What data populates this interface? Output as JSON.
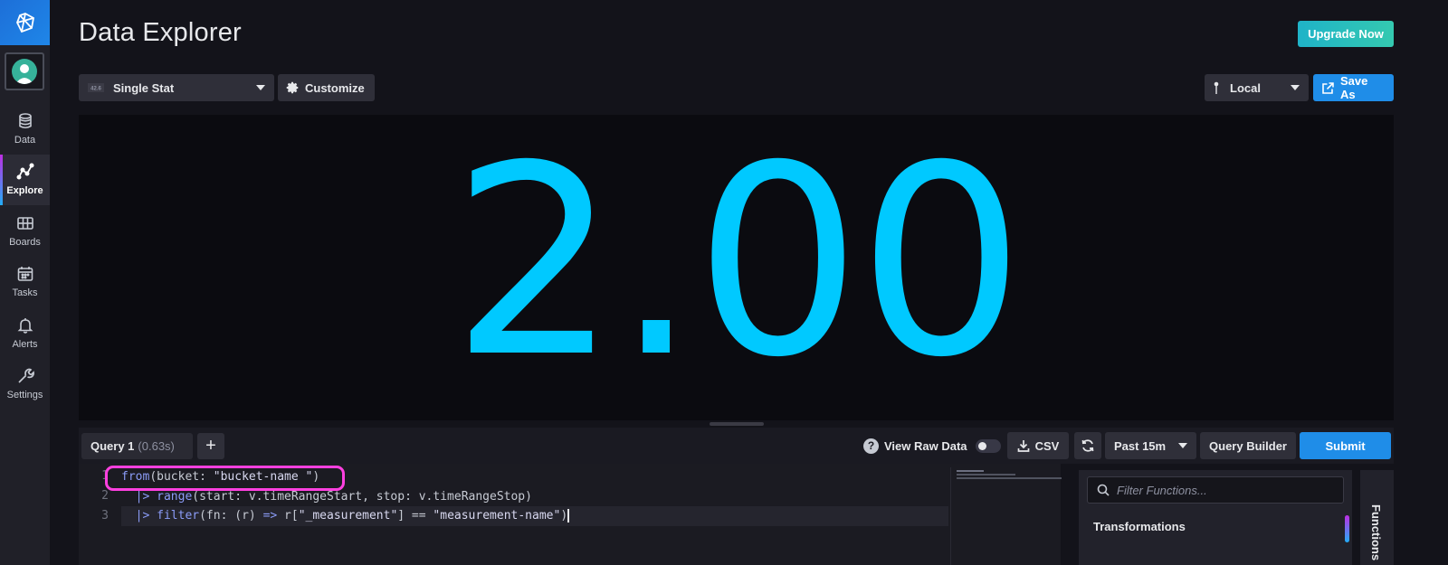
{
  "page": {
    "title": "Data Explorer"
  },
  "header": {
    "upgrade_label": "Upgrade Now"
  },
  "sidebar": {
    "items": [
      {
        "label": "Data",
        "icon": "database-icon"
      },
      {
        "label": "Explore",
        "icon": "graph-icon",
        "active": true
      },
      {
        "label": "Boards",
        "icon": "grid-icon"
      },
      {
        "label": "Tasks",
        "icon": "calendar-icon"
      },
      {
        "label": "Alerts",
        "icon": "bell-icon"
      },
      {
        "label": "Settings",
        "icon": "wrench-icon"
      }
    ]
  },
  "toolbar": {
    "visualization_type": "Single Stat",
    "customize_label": "Customize",
    "timezone": "Local",
    "save_as_label": "Save As"
  },
  "visualization": {
    "stat_value": "2.00",
    "color": "#00c9ff"
  },
  "query_bar": {
    "tab_label": "Query 1",
    "tab_time": "(0.63s)",
    "add_label": "+",
    "raw_data_label": "View Raw Data",
    "raw_data_enabled": false,
    "csv_label": "CSV",
    "time_range": "Past 15m",
    "query_builder_label": "Query Builder",
    "submit_label": "Submit"
  },
  "editor": {
    "lines": [
      {
        "num": "1",
        "pre": "",
        "fn": "from",
        "rest": "(bucket: ",
        "str": "\"bucket-name \"",
        "post": ")"
      },
      {
        "num": "2",
        "pre": "  ",
        "op": "|>",
        "fn": "range",
        "rest": "(start: v.timeRangeStart, stop: v.timeRangeStop)"
      },
      {
        "num": "3",
        "pre": "  ",
        "op": "|>",
        "fn": "filter",
        "rest": "(fn: (r) ",
        "arrow": "=>",
        "rest2": " r[",
        "str": "\"_measurement\"",
        "mid": "] == ",
        "str2": "\"measurement-name\"",
        "post": ")"
      }
    ]
  },
  "functions": {
    "search_placeholder": "Filter Functions...",
    "category": "Transformations",
    "tab_label": "Functions"
  }
}
